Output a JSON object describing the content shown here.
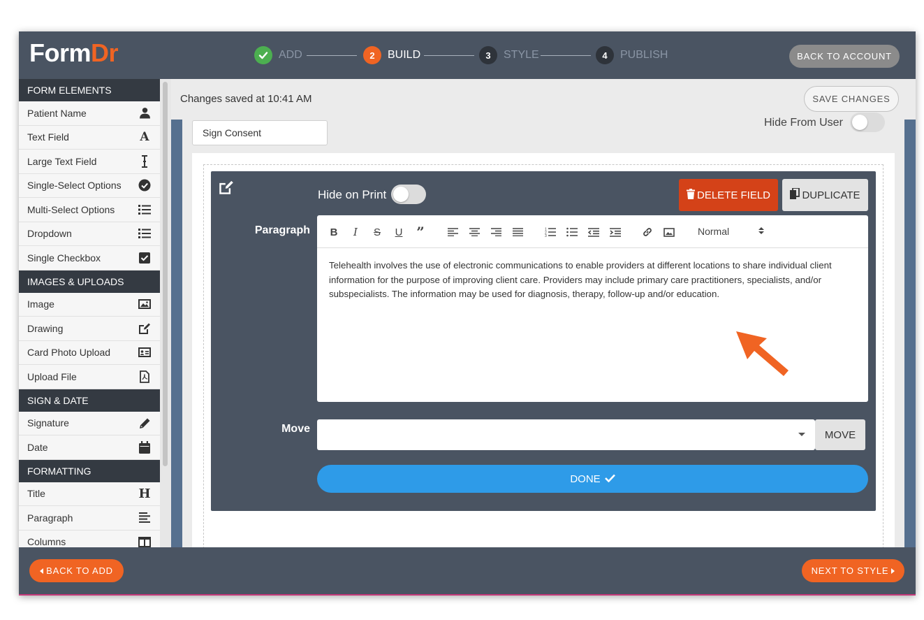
{
  "app": {
    "logo_part1": "Form",
    "logo_part2": "Dr"
  },
  "steps": [
    {
      "number": "",
      "label": "ADD",
      "state": "complete"
    },
    {
      "number": "2",
      "label": "BUILD",
      "state": "active"
    },
    {
      "number": "3",
      "label": "STYLE",
      "state": "pending"
    },
    {
      "number": "4",
      "label": "PUBLISH",
      "state": "pending"
    }
  ],
  "header": {
    "back_to_account": "BACK TO ACCOUNT"
  },
  "sidebar": {
    "sections": [
      {
        "title": "FORM ELEMENTS",
        "items": [
          {
            "label": "Patient Name",
            "icon": "user-icon"
          },
          {
            "label": "Text Field",
            "icon": "font-icon"
          },
          {
            "label": "Large Text Field",
            "icon": "text-cursor-icon"
          },
          {
            "label": "Single-Select Options",
            "icon": "check-circle-icon"
          },
          {
            "label": "Multi-Select Options",
            "icon": "list-icon"
          },
          {
            "label": "Dropdown",
            "icon": "list-icon"
          },
          {
            "label": "Single Checkbox",
            "icon": "checkbox-icon"
          }
        ]
      },
      {
        "title": "IMAGES & UPLOADS",
        "items": [
          {
            "label": "Image",
            "icon": "image-icon"
          },
          {
            "label": "Drawing",
            "icon": "edit-icon"
          },
          {
            "label": "Card Photo Upload",
            "icon": "id-card-icon"
          },
          {
            "label": "Upload File",
            "icon": "pdf-file-icon"
          }
        ]
      },
      {
        "title": "SIGN & DATE",
        "items": [
          {
            "label": "Signature",
            "icon": "pencil-icon"
          },
          {
            "label": "Date",
            "icon": "calendar-icon"
          }
        ]
      },
      {
        "title": "FORMATTING",
        "items": [
          {
            "label": "Title",
            "icon": "heading-icon"
          },
          {
            "label": "Paragraph",
            "icon": "align-left-icon"
          },
          {
            "label": "Columns",
            "icon": "columns-icon"
          }
        ]
      }
    ]
  },
  "main": {
    "status": "Changes saved at 10:41 AM",
    "save_button": "SAVE CHANGES",
    "form_name": "Sign Consent",
    "hide_from_user": "Hide From User",
    "hide_from_user_on": false
  },
  "field_editor": {
    "hide_on_print_label": "Hide on Print",
    "hide_on_print_on": false,
    "delete_button": "DELETE FIELD",
    "duplicate_button": "DUPLICATE",
    "paragraph_label": "Paragraph",
    "format_select": "Normal",
    "paragraph_text": "Telehealth involves the use of electronic communications to enable providers at different locations to share individual client information for the purpose of improving client care. Providers may include primary care practitioners, specialists, and/or subspecialists. The information may be used for diagnosis, therapy, follow-up and/or education.",
    "move_label": "Move",
    "move_select_value": "",
    "move_button": "MOVE",
    "done_button": "DONE"
  },
  "footer": {
    "back_to_add": "BACK TO ADD",
    "next_to_style": "NEXT TO STYLE"
  },
  "colors": {
    "brand_orange": "#f06423",
    "header_slate": "#4a5462",
    "done_blue": "#2e9be8",
    "delete_red": "#d44218",
    "step_done_green": "#4caf50"
  }
}
